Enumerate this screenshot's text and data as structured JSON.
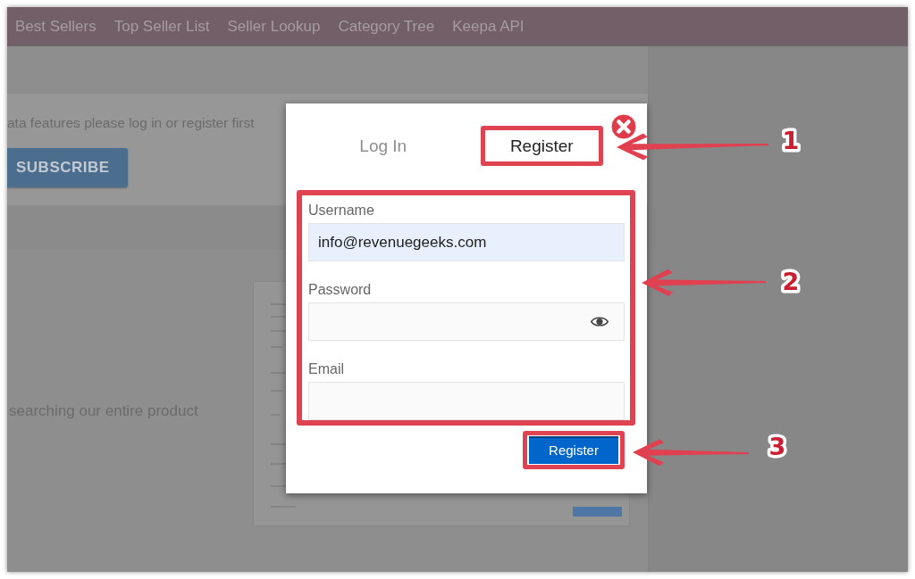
{
  "nav": {
    "links": [
      "Best Sellers",
      "Top Seller List",
      "Seller Lookup",
      "Category Tree",
      "Keepa API"
    ]
  },
  "page": {
    "notice": "ata features please log in or register first",
    "subscribe_button": "SUBSCRIBE",
    "description": "searching our entire product"
  },
  "dialog": {
    "tabs": [
      {
        "label": "Log In",
        "selected": false,
        "highlighted": false
      },
      {
        "label": "Register",
        "selected": true,
        "highlighted": true
      }
    ],
    "form": {
      "highlighted": true,
      "fields": [
        {
          "label": "Username",
          "kind": "text",
          "value": "info@revenuegeeks.com",
          "autofilled": true
        },
        {
          "label": "Password",
          "kind": "password",
          "autofilled": false
        },
        {
          "label": "Email",
          "kind": "text",
          "autofilled": false
        }
      ]
    },
    "submit_button": {
      "label": "Register",
      "highlighted": true
    }
  },
  "annotations": [
    {
      "number": "1"
    },
    {
      "number": "2"
    },
    {
      "number": "3"
    }
  ]
}
